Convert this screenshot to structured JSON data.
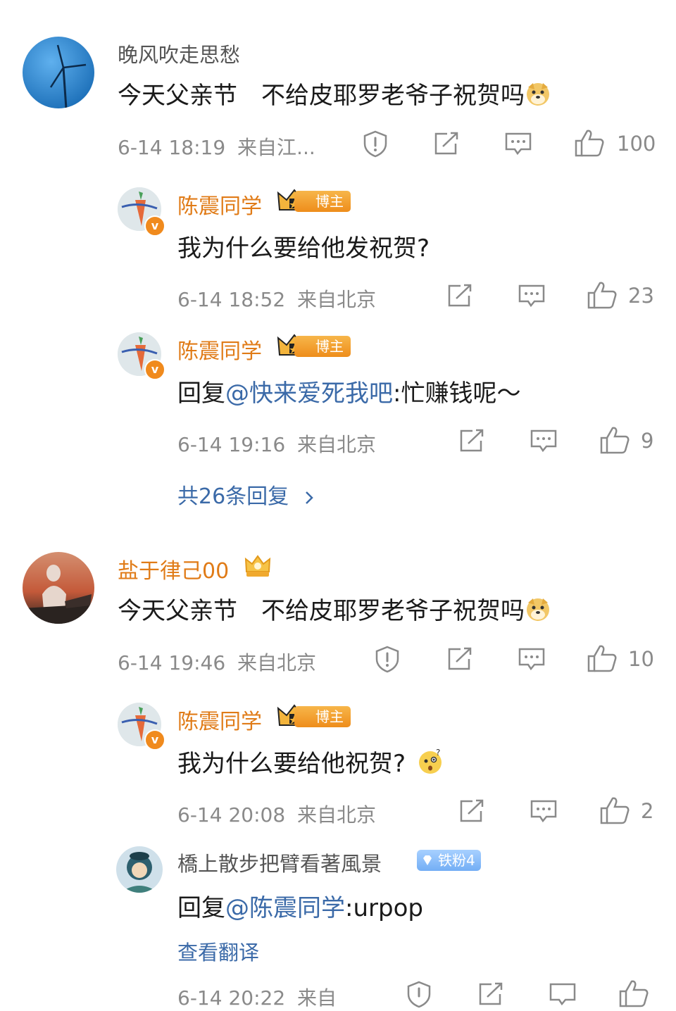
{
  "comments": [
    {
      "user": "晚风吹走思愁",
      "text": "今天父亲节　不给皮耶罗老爷子祝贺吗",
      "emoji_icon": "doge-emoji",
      "time": "6-14 18:19",
      "location": "来自江...",
      "likes": "100",
      "replies": [
        {
          "user": "陈震同学",
          "badge": "博主",
          "text": "我为什么要给他发祝贺?",
          "time": "6-14 18:52",
          "location": "来自北京",
          "likes": "23"
        },
        {
          "user": "陈震同学",
          "badge": "博主",
          "reply_prefix": "回复",
          "mention": "@快来爱死我吧",
          "text": ":忙赚钱呢～",
          "time": "6-14 19:16",
          "location": "来自北京",
          "likes": "9"
        }
      ],
      "more_replies": "共26条回复",
      "more_icon": "chevron-right-icon"
    },
    {
      "user": "盐于律己00",
      "text": "今天父亲节　不给皮耶罗老爷子祝贺吗",
      "emoji_icon": "doge-emoji",
      "time": "6-14 19:46",
      "location": "来自北京",
      "likes": "10",
      "replies": [
        {
          "user": "陈震同学",
          "badge": "博主",
          "text": "我为什么要给他祝贺?",
          "emoji_icon": "confused-emoji",
          "time": "6-14 20:08",
          "location": "来自北京",
          "likes": "2"
        },
        {
          "user": "橋上散步把臂看著風景",
          "badge": "铁粉4",
          "reply_prefix": "回复",
          "mention": "@陈震同学",
          "text": ":urpop",
          "translate": "查看翻译",
          "time": "6-14 20:22",
          "location": "来自"
        }
      ]
    }
  ],
  "colors": {
    "username_orange": "#e07b17",
    "mention_blue": "#3b6aa8",
    "meta_gray": "#8a8a8a"
  }
}
